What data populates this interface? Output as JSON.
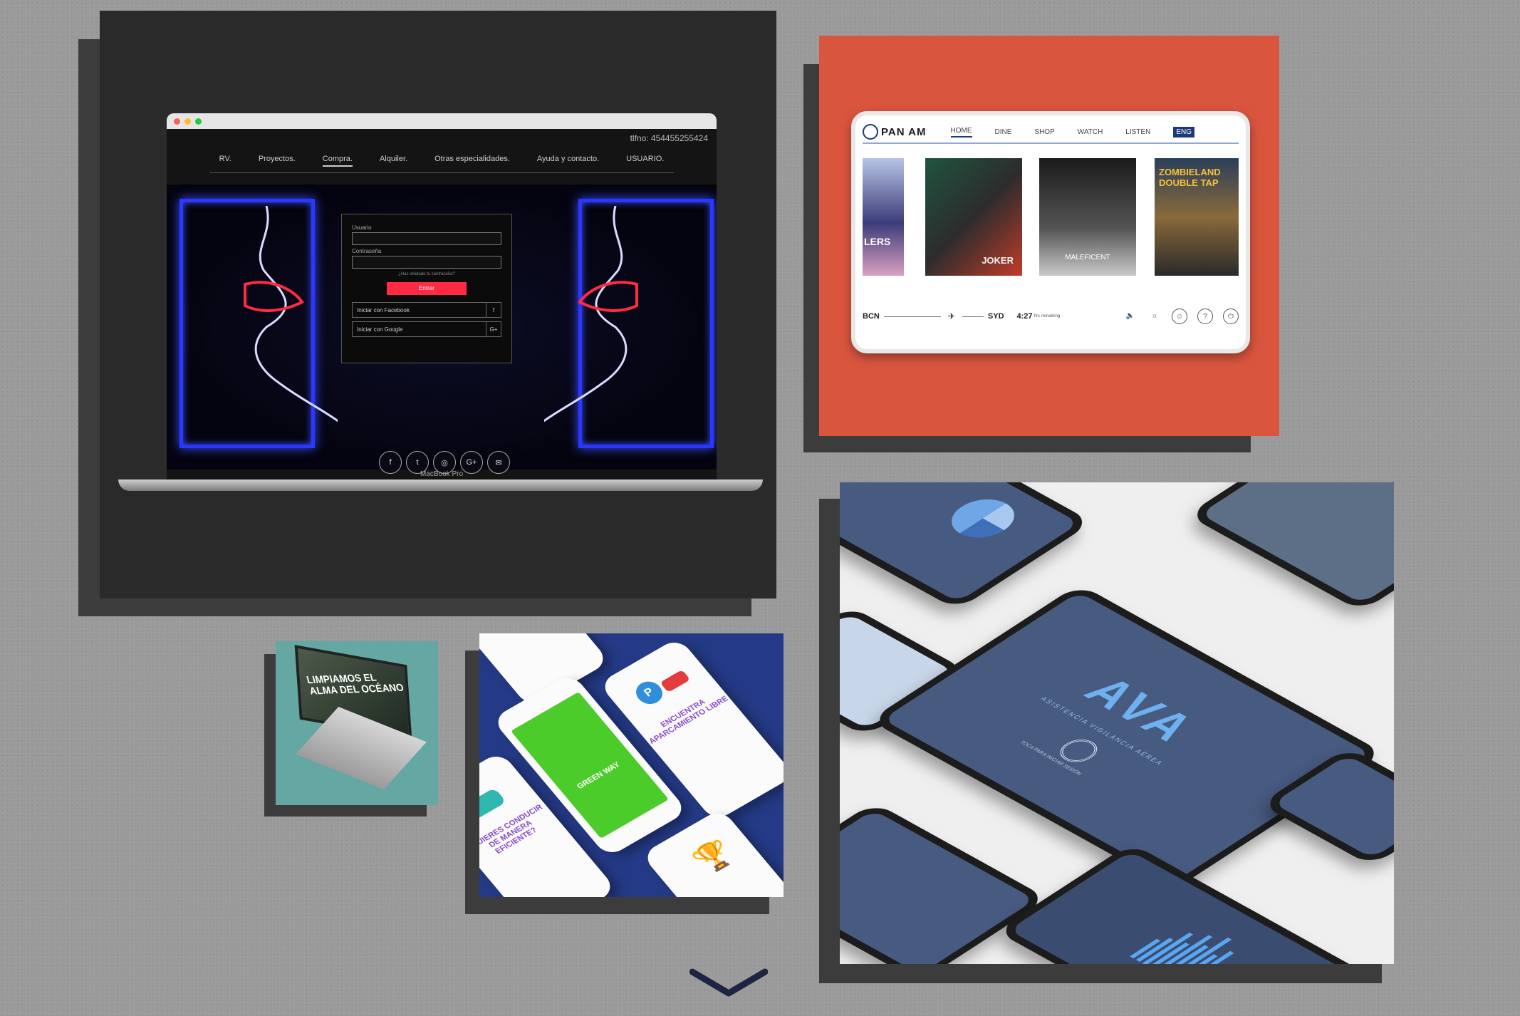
{
  "laptop_card": {
    "phone": "tlfno: 454455255424",
    "nav": [
      "RV.",
      "Proyectos.",
      "Compra.",
      "Alquiler.",
      "Otras especialidades.",
      "Ayuda y contacto.",
      "USUARIO."
    ],
    "login": {
      "user_label": "Usuario",
      "password_label": "Contraseña",
      "forgot": "¿Has olvidado tu contraseña?",
      "submit": "Entrar",
      "facebook": "Iniciar con Facebook",
      "google": "Iniciar con Google"
    },
    "social_icons": [
      "f",
      "t",
      "◎",
      "G+",
      "✉"
    ],
    "device_label": "MacBook Pro"
  },
  "panam_card": {
    "logo": "PAN AM",
    "nav": [
      "HOME",
      "DINE",
      "SHOP",
      "WATCH",
      "LISTEN"
    ],
    "language": "ENG",
    "posters": [
      "LERS",
      "JOKER",
      "MALEFICENT",
      "ZOMBIELAND DOUBLE TAP"
    ],
    "route_from": "BCN",
    "route_to": "SYD",
    "time": "4:27",
    "time_unit": "hrs",
    "remaining": "remaining"
  },
  "ava_card": {
    "logo": "AVA",
    "subtitle": "ASISTENCIA VIGILANCIA AÉREA",
    "fingerprint_hint": "TOCA PARA INICIAR SESIÓN"
  },
  "ocean_card": {
    "title": "LIMPIAMOS EL ALMA DEL OCÉANO"
  },
  "green_card": {
    "brand": "GREEN WAY",
    "phone_parking": "ENCUENTRA APARCAMIENTO LIBRE",
    "phone_drive": "¿QUIERES CONDUCIR DE MANERA EFICIENTE?"
  },
  "colors": {
    "page_bg": "#9a9a9a",
    "panam_bg": "#d9553e",
    "ocean_bg": "#64a7a3",
    "green_bg": "#243a86",
    "neon_blue": "#2a38ff",
    "neon_red": "#ff2a44",
    "ava_blue": "#6fb0ef"
  },
  "icons": [
    "chevron-down-icon",
    "fingerprint-icon",
    "volume-icon",
    "brightness-icon",
    "help-icon",
    "power-icon"
  ]
}
